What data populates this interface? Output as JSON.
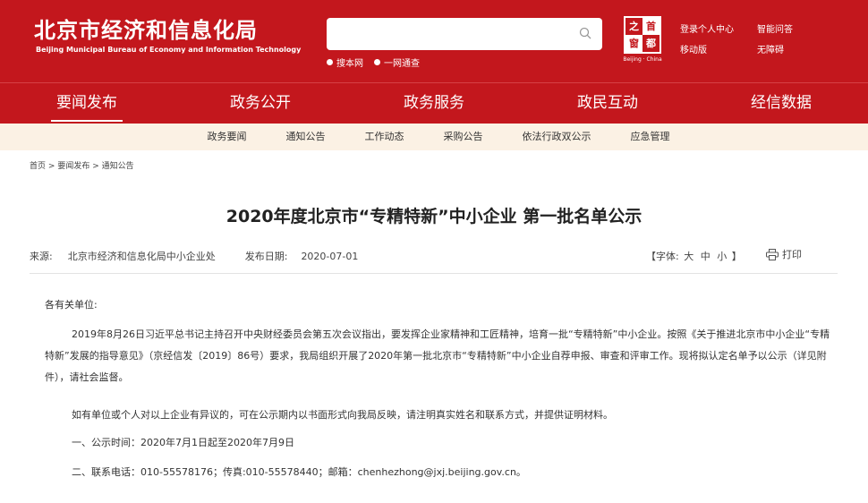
{
  "header": {
    "title": "北京市经济和信息化局",
    "subtitle": "Beijing Municipal Bureau of Economy and Information Technology",
    "search": {
      "placeholder": "",
      "options": [
        "搜本网",
        "一网通查"
      ]
    },
    "emblem": {
      "chars": [
        "之",
        "首",
        "窗",
        "都"
      ],
      "caption": "Beijing · China"
    },
    "util_links": {
      "login": "登录个人中心",
      "qa": "智能问答",
      "mobile": "移动版",
      "accessible": "无障碍"
    },
    "brand_color": "#c3171d"
  },
  "main_nav": [
    "要闻发布",
    "政务公开",
    "政务服务",
    "政民互动",
    "经信数据"
  ],
  "sub_nav": [
    "政务要闻",
    "通知公告",
    "工作动态",
    "采购公告",
    "依法行政双公示",
    "应急管理"
  ],
  "breadcrumb": {
    "home": "首页",
    "sep": ">",
    "level1": "要闻发布",
    "level2": "通知公告"
  },
  "article": {
    "title": "2020年度北京市“专精特新”中小企业 第一批名单公示",
    "source_label": "来源:",
    "source": "北京市经济和信息化局中小企业处",
    "date_label": "发布日期:",
    "date": "2020-07-01",
    "font_label": "【字体:",
    "font_sizes": [
      "大",
      "中",
      "小"
    ],
    "font_close": "】",
    "print_label": "打印",
    "greeting": "各有关单位:",
    "paragraph_main": "2019年8月26日习近平总书记主持召开中央财经委员会第五次会议指出，要发挥企业家精神和工匠精神，培育一批“专精特新”中小企业。按照《关于推进北京市中小企业“专精特新”发展的指导意见》（京经信发〔2019〕86号）要求，我局组织开展了2020年第一批北京市“专精特新”中小企业自荐申报、审查和评审工作。现将拟认定名单予以公示（详见附件），请社会监督。",
    "paragraph_objection": "如有单位或个人对以上企业有异议的，可在公示期内以书面形式向我局反映，请注明真实姓名和联系方式，并提供证明材料。",
    "item_time": "一、公示时间：2020年7月1日起至2020年7月9日",
    "item_contact": "二、联系电话：010-55578176；传真:010-55578440；邮箱：chenhezhong@jxj.beijing.gov.cn。"
  }
}
